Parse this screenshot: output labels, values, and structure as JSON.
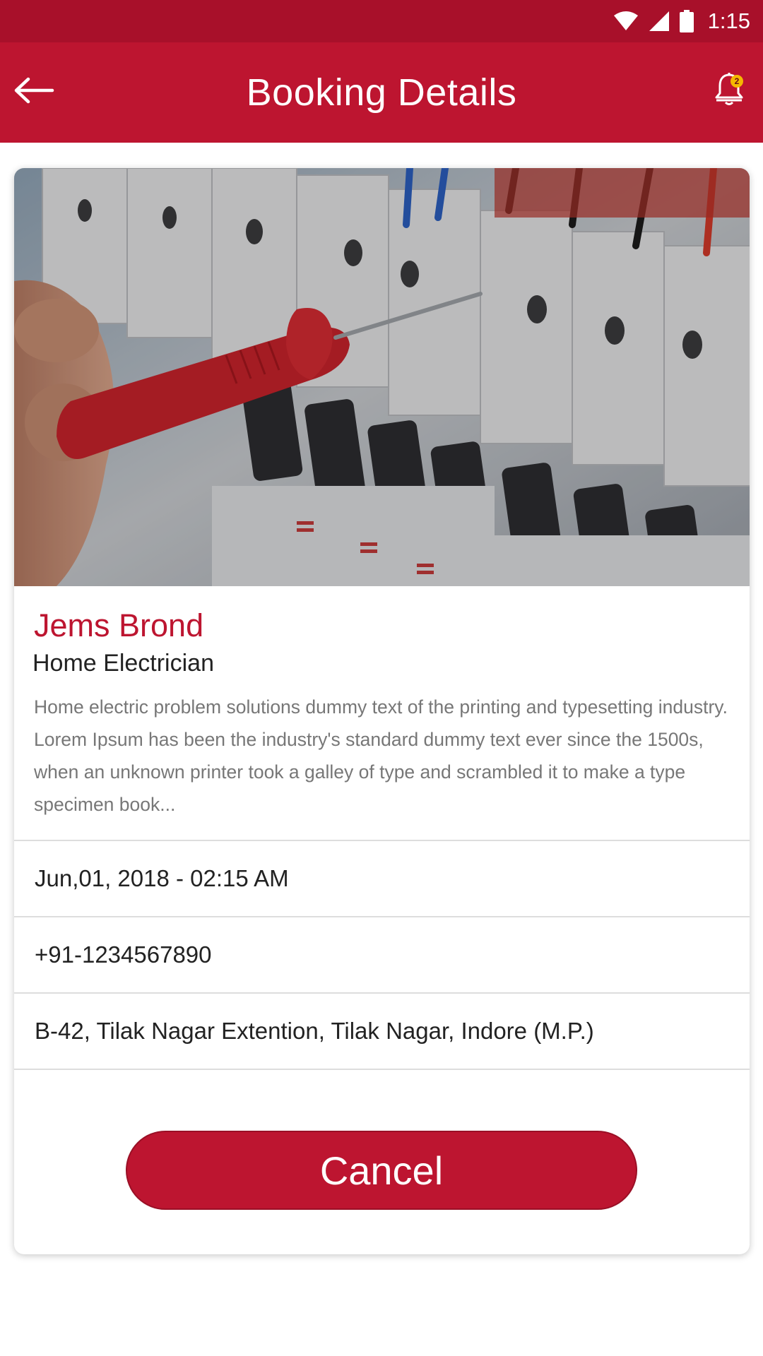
{
  "status_bar": {
    "time": "1:15",
    "icons": [
      "wifi-icon",
      "cell-signal-icon",
      "battery-icon"
    ]
  },
  "app_bar": {
    "title": "Booking Details",
    "back_icon": "arrow-left-icon",
    "notification_icon": "bell-icon",
    "notification_count": "2"
  },
  "booking": {
    "image": "electrician-testing-circuit-breaker",
    "provider_name": "Jems Brond",
    "provider_role": "Home Electrician",
    "description": "Home electric problem solutions dummy text of the printing and typesetting industry. Lorem Ipsum has been the industry's standard dummy text ever since the 1500s, when an unknown printer took a galley of type and scrambled it to make a type specimen book...",
    "date_time": "Jun,01, 2018 - 02:15 AM",
    "phone": "+91-1234567890",
    "address": "B-42, Tilak Nagar Extention, Tilak Nagar, Indore (M.P.)"
  },
  "actions": {
    "cancel_label": "Cancel"
  },
  "colors": {
    "primary": "#bd1530",
    "status_bar": "#a8102a",
    "badge": "#f5b800",
    "secondary_text": "#777777"
  }
}
